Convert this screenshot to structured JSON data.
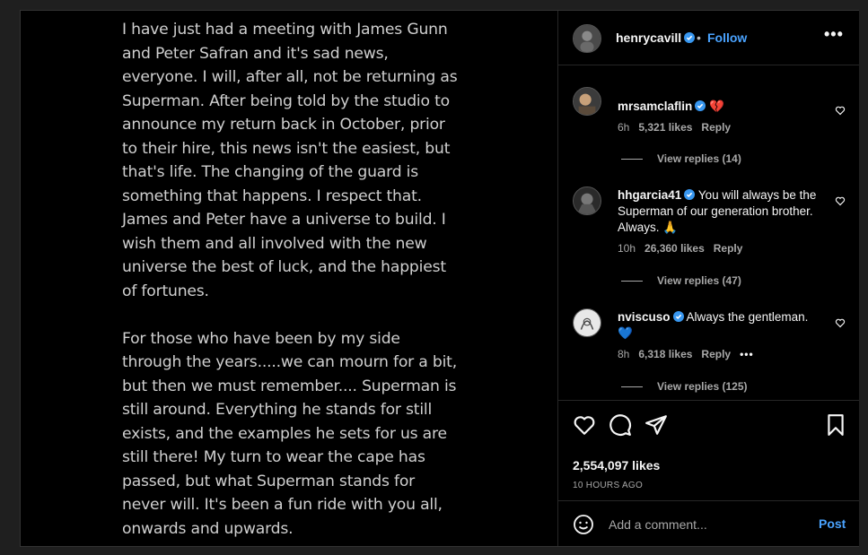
{
  "post": {
    "text": "I have just had a meeting with James Gunn\nand Peter Safran and it's sad news,\neveryone. I will, after all, not be returning as\nSuperman. After being told by the studio to\nannounce my return back in October, prior\nto their hire, this news isn't the easiest, but\nthat's life. The changing of the guard is\nsomething that happens. I respect that.\nJames and Peter have a universe to build. I\nwish them and all involved with the new\nuniverse the best of luck, and the happiest\nof fortunes.\n\nFor those who have been by my side\nthrough the years.....we can mourn for a bit,\nbut then we must remember.... Superman is\nstill around. Everything he stands for still\nexists, and the examples he sets for us are\nstill there! My turn to wear the cape has\npassed, but what Superman stands for\nnever will. It's been a fun ride with you all,\nonwards and upwards."
  },
  "header": {
    "username": "henrycavill",
    "separator": "•",
    "follow_label": "Follow",
    "more_label": "•••"
  },
  "comments": [
    {
      "username": "mrsamclaflin",
      "text": "💔",
      "age": "6h",
      "likes": "5,321 likes",
      "reply_label": "Reply",
      "view_replies": "View replies (14)"
    },
    {
      "username": "hhgarcia41",
      "text": "You will always be the Superman of our generation brother. Always. 🙏",
      "age": "10h",
      "likes": "26,360 likes",
      "reply_label": "Reply",
      "view_replies": "View replies (47)"
    },
    {
      "username": "nviscuso",
      "text": "Always the gentleman. 💙",
      "age": "8h",
      "likes": "6,318 likes",
      "reply_label": "Reply",
      "more_label": "•••",
      "view_replies": "View replies (125)"
    }
  ],
  "actions": {
    "likes": "2,554,097 likes",
    "time": "10 HOURS AGO"
  },
  "add_comment": {
    "placeholder": "Add a comment...",
    "post_label": "Post"
  },
  "colors": {
    "accent": "#4aa3ff",
    "verified": "#3897f0"
  },
  "icons": [
    "verified-badge",
    "heart-icon",
    "comment-icon",
    "share-icon",
    "bookmark-icon",
    "emoji-icon",
    "more-icon"
  ]
}
